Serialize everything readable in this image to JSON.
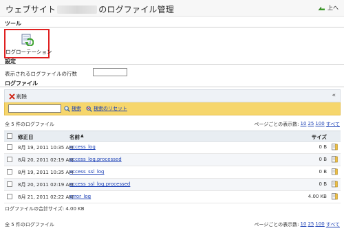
{
  "header": {
    "title_prefix": "ウェブサイト",
    "title_suffix": "のログファイル管理",
    "up_label": "上へ"
  },
  "tools": {
    "section_label": "ツール",
    "log_rotation_label": "ログローテーション"
  },
  "settings": {
    "section_label": "設定",
    "lines_label": "表示されるログファイルの行数",
    "lines_value": ""
  },
  "logfiles": {
    "section_label": "ログファイル",
    "delete_label": "削除",
    "search_value": "",
    "search_label": "検索",
    "reset_label": "検索のリセット",
    "count_text": "全 5 件のログファイル",
    "per_page_label": "ページごとの表示数:",
    "per_page_options": [
      "10",
      "25",
      "100",
      "すべて"
    ],
    "columns": {
      "modified": "修正日",
      "name": "名前",
      "sort_indicator": "▲",
      "size": "サイズ"
    },
    "rows": [
      {
        "modified": "8月 19, 2011 10:35 AM",
        "name": "access_log",
        "size": "0 B"
      },
      {
        "modified": "8月 20, 2011 02:19 AM",
        "name": "access_log.processed",
        "size": "0 B"
      },
      {
        "modified": "8月 19, 2011 10:35 AM",
        "name": "access_ssl_log",
        "size": "0 B"
      },
      {
        "modified": "8月 20, 2011 02:19 AM",
        "name": "access_ssl_log.processed",
        "size": "0 B"
      },
      {
        "modified": "8月 21, 2011 02:22 AM",
        "name": "error_log",
        "size": "4.00 KB"
      }
    ],
    "total_text": "ログファイルの合計サイズ: 4.00 KB"
  },
  "colors": {
    "accent_red": "#e02020",
    "link_blue": "#1a3fb5",
    "search_bar": "#f6d66c",
    "panel_head": "#eef2f6"
  }
}
